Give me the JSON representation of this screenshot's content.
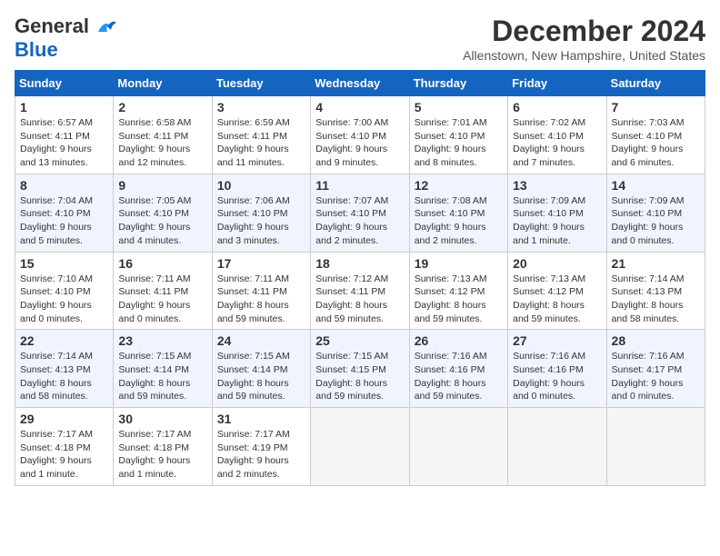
{
  "header": {
    "logo_line1": "General",
    "logo_line2": "Blue",
    "month": "December 2024",
    "location": "Allenstown, New Hampshire, United States"
  },
  "weekdays": [
    "Sunday",
    "Monday",
    "Tuesday",
    "Wednesday",
    "Thursday",
    "Friday",
    "Saturday"
  ],
  "weeks": [
    [
      {
        "day": "1",
        "sunrise": "6:57 AM",
        "sunset": "4:11 PM",
        "daylight": "9 hours and 13 minutes."
      },
      {
        "day": "2",
        "sunrise": "6:58 AM",
        "sunset": "4:11 PM",
        "daylight": "9 hours and 12 minutes."
      },
      {
        "day": "3",
        "sunrise": "6:59 AM",
        "sunset": "4:11 PM",
        "daylight": "9 hours and 11 minutes."
      },
      {
        "day": "4",
        "sunrise": "7:00 AM",
        "sunset": "4:10 PM",
        "daylight": "9 hours and 9 minutes."
      },
      {
        "day": "5",
        "sunrise": "7:01 AM",
        "sunset": "4:10 PM",
        "daylight": "9 hours and 8 minutes."
      },
      {
        "day": "6",
        "sunrise": "7:02 AM",
        "sunset": "4:10 PM",
        "daylight": "9 hours and 7 minutes."
      },
      {
        "day": "7",
        "sunrise": "7:03 AM",
        "sunset": "4:10 PM",
        "daylight": "9 hours and 6 minutes."
      }
    ],
    [
      {
        "day": "8",
        "sunrise": "7:04 AM",
        "sunset": "4:10 PM",
        "daylight": "9 hours and 5 minutes."
      },
      {
        "day": "9",
        "sunrise": "7:05 AM",
        "sunset": "4:10 PM",
        "daylight": "9 hours and 4 minutes."
      },
      {
        "day": "10",
        "sunrise": "7:06 AM",
        "sunset": "4:10 PM",
        "daylight": "9 hours and 3 minutes."
      },
      {
        "day": "11",
        "sunrise": "7:07 AM",
        "sunset": "4:10 PM",
        "daylight": "9 hours and 2 minutes."
      },
      {
        "day": "12",
        "sunrise": "7:08 AM",
        "sunset": "4:10 PM",
        "daylight": "9 hours and 2 minutes."
      },
      {
        "day": "13",
        "sunrise": "7:09 AM",
        "sunset": "4:10 PM",
        "daylight": "9 hours and 1 minute."
      },
      {
        "day": "14",
        "sunrise": "7:09 AM",
        "sunset": "4:10 PM",
        "daylight": "9 hours and 0 minutes."
      }
    ],
    [
      {
        "day": "15",
        "sunrise": "7:10 AM",
        "sunset": "4:10 PM",
        "daylight": "9 hours and 0 minutes."
      },
      {
        "day": "16",
        "sunrise": "7:11 AM",
        "sunset": "4:11 PM",
        "daylight": "9 hours and 0 minutes."
      },
      {
        "day": "17",
        "sunrise": "7:11 AM",
        "sunset": "4:11 PM",
        "daylight": "8 hours and 59 minutes."
      },
      {
        "day": "18",
        "sunrise": "7:12 AM",
        "sunset": "4:11 PM",
        "daylight": "8 hours and 59 minutes."
      },
      {
        "day": "19",
        "sunrise": "7:13 AM",
        "sunset": "4:12 PM",
        "daylight": "8 hours and 59 minutes."
      },
      {
        "day": "20",
        "sunrise": "7:13 AM",
        "sunset": "4:12 PM",
        "daylight": "8 hours and 59 minutes."
      },
      {
        "day": "21",
        "sunrise": "7:14 AM",
        "sunset": "4:13 PM",
        "daylight": "8 hours and 58 minutes."
      }
    ],
    [
      {
        "day": "22",
        "sunrise": "7:14 AM",
        "sunset": "4:13 PM",
        "daylight": "8 hours and 58 minutes."
      },
      {
        "day": "23",
        "sunrise": "7:15 AM",
        "sunset": "4:14 PM",
        "daylight": "8 hours and 59 minutes."
      },
      {
        "day": "24",
        "sunrise": "7:15 AM",
        "sunset": "4:14 PM",
        "daylight": "8 hours and 59 minutes."
      },
      {
        "day": "25",
        "sunrise": "7:15 AM",
        "sunset": "4:15 PM",
        "daylight": "8 hours and 59 minutes."
      },
      {
        "day": "26",
        "sunrise": "7:16 AM",
        "sunset": "4:16 PM",
        "daylight": "8 hours and 59 minutes."
      },
      {
        "day": "27",
        "sunrise": "7:16 AM",
        "sunset": "4:16 PM",
        "daylight": "9 hours and 0 minutes."
      },
      {
        "day": "28",
        "sunrise": "7:16 AM",
        "sunset": "4:17 PM",
        "daylight": "9 hours and 0 minutes."
      }
    ],
    [
      {
        "day": "29",
        "sunrise": "7:17 AM",
        "sunset": "4:18 PM",
        "daylight": "9 hours and 1 minute."
      },
      {
        "day": "30",
        "sunrise": "7:17 AM",
        "sunset": "4:18 PM",
        "daylight": "9 hours and 1 minute."
      },
      {
        "day": "31",
        "sunrise": "7:17 AM",
        "sunset": "4:19 PM",
        "daylight": "9 hours and 2 minutes."
      },
      null,
      null,
      null,
      null
    ]
  ],
  "labels": {
    "sunrise": "Sunrise:",
    "sunset": "Sunset:",
    "daylight": "Daylight:"
  }
}
